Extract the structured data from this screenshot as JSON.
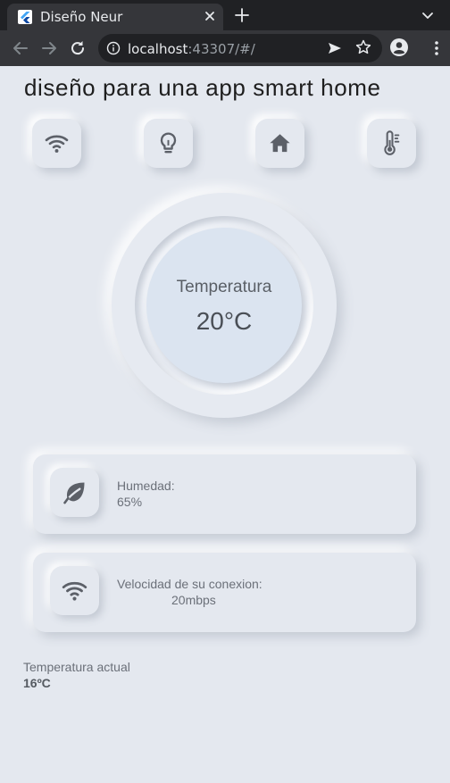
{
  "browser": {
    "tab_title": "Diseño Neur",
    "url_host": "localhost",
    "url_rest": ":43307/#/"
  },
  "app": {
    "title": "diseño para una app smart home",
    "top_icons": [
      "wifi-icon",
      "lightbulb-icon",
      "home-icon",
      "thermometer-icon"
    ],
    "dial": {
      "label": "Temperatura",
      "value": "20°C"
    },
    "cards": {
      "humidity": {
        "icon": "leaf-icon",
        "label": "Humedad:",
        "value": "65%"
      },
      "connection": {
        "icon": "wifi-icon",
        "label": "Velocidad de su conexion:",
        "value": "20mbps"
      }
    },
    "current_temp": {
      "label": "Temperatura actual",
      "value": "16ºC"
    }
  },
  "colors": {
    "background": "#e4e8ef",
    "dial_center": "#dbe4f0",
    "browser_dark": "#202124",
    "browser_toolbar": "#35363a",
    "icon": "#5c6068"
  }
}
